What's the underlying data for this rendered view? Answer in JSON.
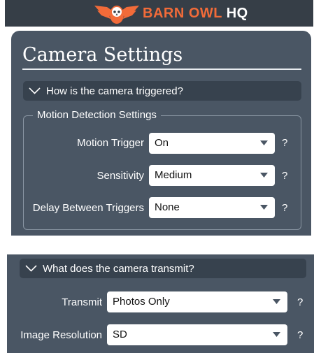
{
  "colors": {
    "header_bg": "#363e47",
    "panel_bg": "#4a5664",
    "accordion_bg": "#37424e",
    "brand_orange": "#f26b39",
    "text": "#ffffff"
  },
  "header": {
    "logo_icon": "owl-icon",
    "brand_part1": "BARN OWL",
    "brand_part2": "HQ"
  },
  "page": {
    "title": "Camera Settings"
  },
  "sections": [
    {
      "question": "How is the camera triggered?",
      "expanded": true,
      "icon": "chevron-down-icon",
      "group_legend": "Motion Detection Settings",
      "fields": [
        {
          "label": "Motion Trigger",
          "value": "On",
          "help": "?"
        },
        {
          "label": "Sensitivity",
          "value": "Medium",
          "help": "?"
        },
        {
          "label": "Delay Between Triggers",
          "value": "None",
          "help": "?"
        }
      ]
    },
    {
      "question": "What does the camera transmit?",
      "expanded": true,
      "icon": "chevron-down-icon",
      "fields": [
        {
          "label": "Transmit",
          "value": "Photos Only",
          "help": "?"
        },
        {
          "label": "Image Resolution",
          "value": "SD",
          "help": "?"
        }
      ]
    }
  ]
}
